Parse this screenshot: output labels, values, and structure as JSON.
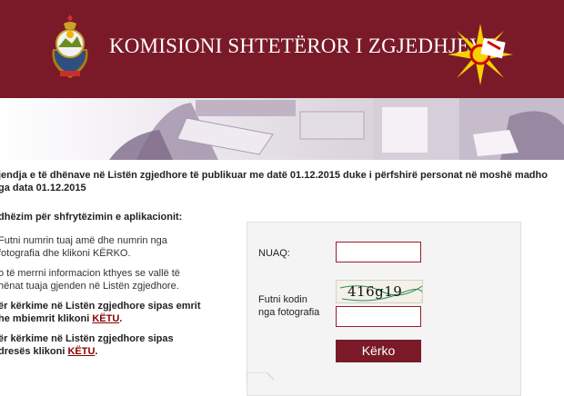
{
  "header": {
    "title": "KOMISIONI SHTETËROR I ZGJEDHJEVE",
    "emblem_icon": "coat-of-arms-icon",
    "flag_icon": "sun-flag-icon"
  },
  "intro": {
    "line1": "jendja e të dhënave në Listën zgjedhore të publikuar me datë 01.12.2015 duke i përfshirë personat në moshë madho",
    "line2": "ga data 01.12.2015"
  },
  "guide": {
    "title": "dhëzim për shfrytëzimin e aplikacionit:",
    "steps": [
      {
        "l1": "Futni numrin tuaj amë dhe numrin nga",
        "l2": "fotografia dhe klikoni KËRKO."
      },
      {
        "l1": "o të merrni informacion kthyes se vallë të",
        "l2": "hënat tuaja gjenden në Listën zgjedhore."
      },
      {
        "l1": "ër kërkime në Listën zgjedhore sipas emrit",
        "l2": "he mbiemrit klikoni ",
        "link": "KËTU",
        "end": "."
      },
      {
        "l1": "ër kërkime në Listën zgjedhore sipas",
        "l2": "dresës klikoni ",
        "link": "KËTU",
        "end": "."
      }
    ]
  },
  "form": {
    "nuaq_label": "NUAQ:",
    "nuaq_value": "",
    "captcha_label_1": "Futni kodin",
    "captcha_label_2": "nga fotografia",
    "captcha_text": "416g19",
    "captcha_value": "",
    "submit_label": "Kërko"
  },
  "colors": {
    "brand": "#7a1a28",
    "accent": "#9b1b2c"
  }
}
